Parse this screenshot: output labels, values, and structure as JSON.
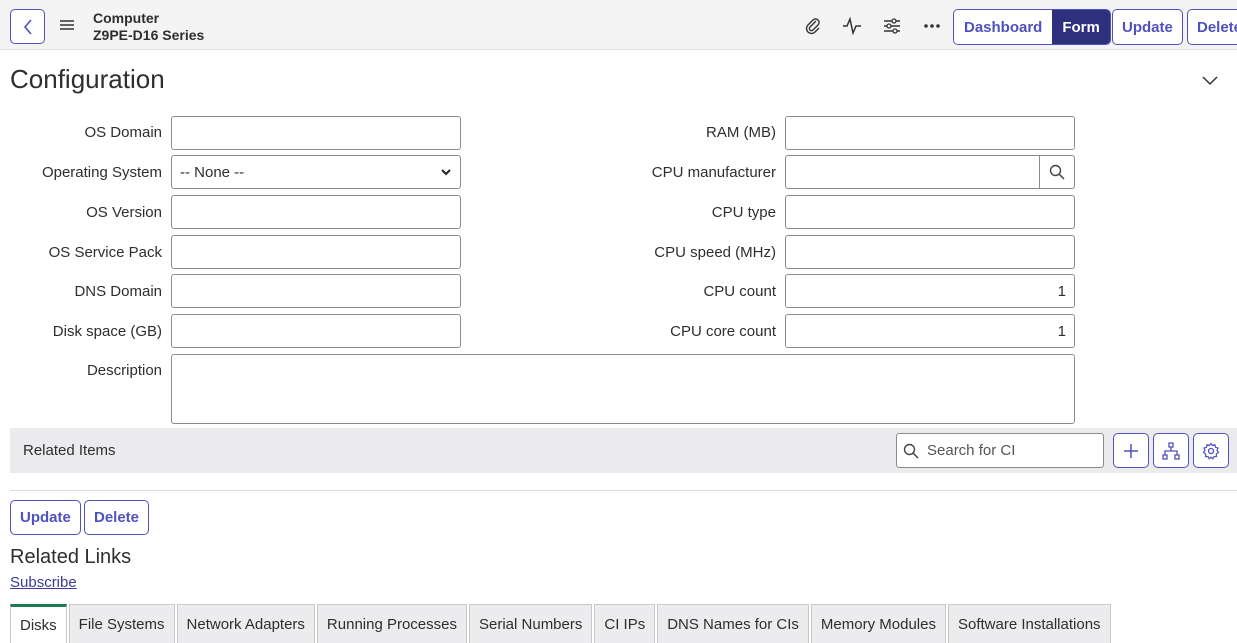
{
  "header": {
    "title_line1": "Computer",
    "title_line2": "Z9PE-D16 Series",
    "icons": [
      "attachment-icon",
      "activity-icon",
      "settings-sliders-icon",
      "more-icon"
    ],
    "view_toggle": {
      "dashboard_label": "Dashboard",
      "form_label": "Form",
      "active": "Form"
    },
    "update_label": "Update",
    "delete_label": "Delete"
  },
  "section": {
    "title": "Configuration",
    "left_fields": [
      {
        "label": "OS Domain",
        "value": ""
      },
      {
        "label": "Operating System",
        "value": "-- None --"
      },
      {
        "label": "OS Version",
        "value": ""
      },
      {
        "label": "OS Service Pack",
        "value": ""
      },
      {
        "label": "DNS Domain",
        "value": ""
      },
      {
        "label": "Disk space (GB)",
        "value": ""
      }
    ],
    "right_fields": [
      {
        "label": "RAM (MB)",
        "value": ""
      },
      {
        "label": "CPU manufacturer",
        "value": ""
      },
      {
        "label": "CPU type",
        "value": ""
      },
      {
        "label": "CPU speed (MHz)",
        "value": ""
      },
      {
        "label": "CPU count",
        "value": "1"
      },
      {
        "label": "CPU core count",
        "value": "1"
      }
    ],
    "description": {
      "label": "Description",
      "value": ""
    }
  },
  "related_items": {
    "title": "Related Items",
    "search_placeholder": "Search for CI"
  },
  "form_buttons": {
    "update_label": "Update",
    "delete_label": "Delete"
  },
  "related_links": {
    "title": "Related Links",
    "subscribe": "Subscribe"
  },
  "tabs": [
    {
      "label": "Disks",
      "active": true
    },
    {
      "label": "File Systems"
    },
    {
      "label": "Network Adapters"
    },
    {
      "label": "Running Processes"
    },
    {
      "label": "Serial Numbers"
    },
    {
      "label": "CI IPs"
    },
    {
      "label": "DNS Names for CIs"
    },
    {
      "label": "Memory Modules"
    },
    {
      "label": "Software Installations"
    }
  ],
  "colors": {
    "accent": "#4f52bd",
    "active_toggle": "#2e2f7d",
    "active_tab": "#1f7a4f"
  }
}
